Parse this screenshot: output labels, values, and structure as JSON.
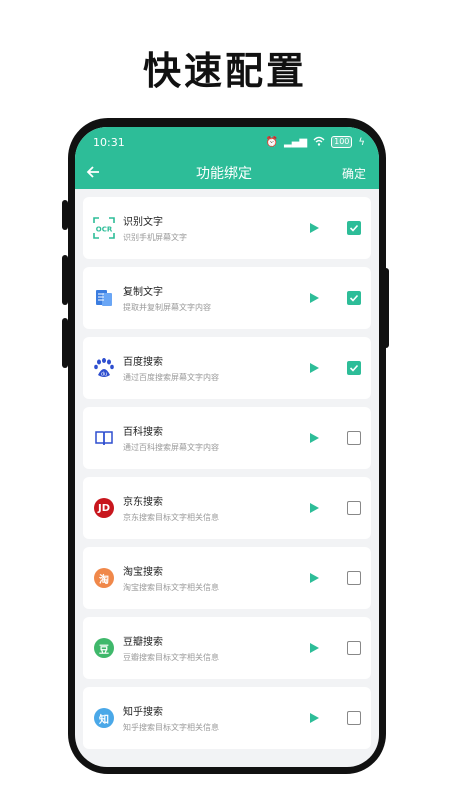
{
  "headline": "快速配置",
  "status": {
    "time": "10:31",
    "battery": "100"
  },
  "appbar": {
    "title": "功能绑定",
    "confirm": "确定"
  },
  "colors": {
    "accent": "#2dbd98"
  },
  "items": [
    {
      "name": "识别文字",
      "desc": "识别手机屏幕文字",
      "icon": "ocr-icon",
      "icon_text": "OCR",
      "checked": true
    },
    {
      "name": "复制文字",
      "desc": "提取并复制屏幕文字内容",
      "icon": "document-copy-icon",
      "checked": true
    },
    {
      "name": "百度搜索",
      "desc": "通过百度搜索屏幕文字内容",
      "icon": "baidu-paw-icon",
      "icon_text": "du",
      "checked": true
    },
    {
      "name": "百科搜索",
      "desc": "通过百科搜索屏幕文字内容",
      "icon": "book-icon",
      "checked": false
    },
    {
      "name": "京东搜索",
      "desc": "京东搜索目标文字相关信息",
      "icon": "jd-icon",
      "icon_text": "JD",
      "icon_color": "#c8161d",
      "checked": false
    },
    {
      "name": "淘宝搜索",
      "desc": "淘宝搜索目标文字相关信息",
      "icon": "taobao-icon",
      "icon_text": "淘",
      "icon_color": "#f0884a",
      "checked": false
    },
    {
      "name": "豆瓣搜索",
      "desc": "豆瓣搜索目标文字相关信息",
      "icon": "douban-icon",
      "icon_text": "豆",
      "icon_color": "#3fb86b",
      "checked": false
    },
    {
      "name": "知乎搜索",
      "desc": "知乎搜索目标文字相关信息",
      "icon": "zhihu-icon",
      "icon_text": "知",
      "icon_color": "#4aa8e8",
      "checked": false
    }
  ]
}
